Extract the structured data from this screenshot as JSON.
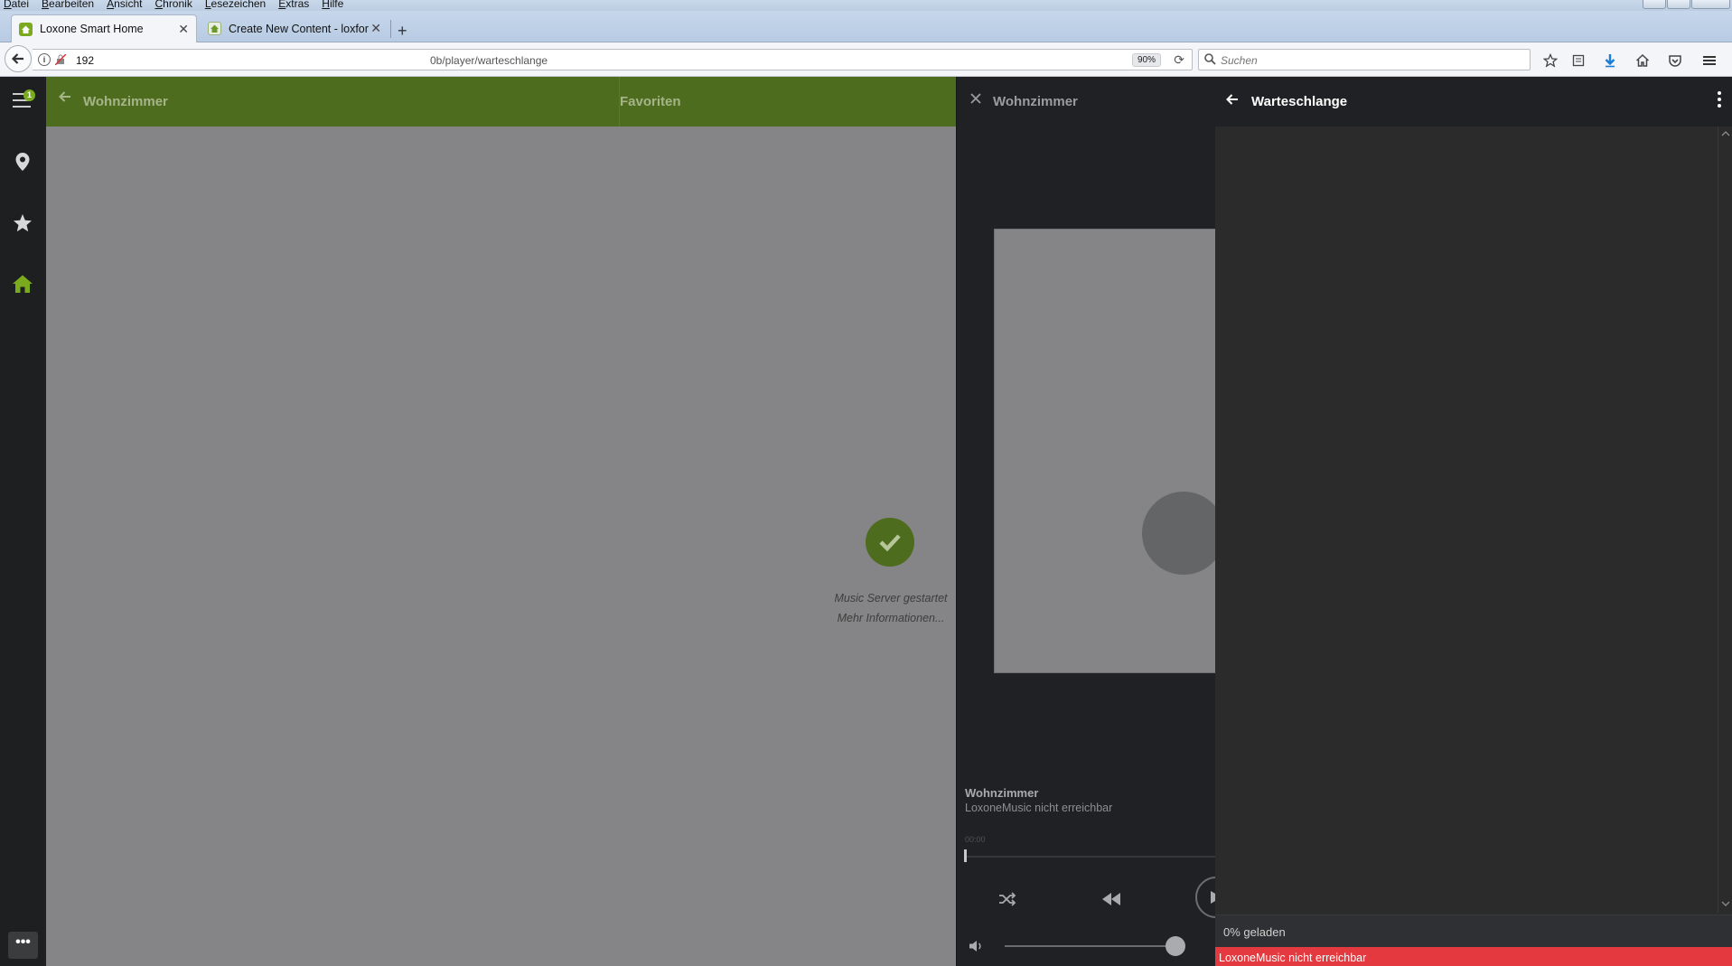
{
  "browser": {
    "menu": [
      "Datei",
      "Bearbeiten",
      "Ansicht",
      "Chronik",
      "Lesezeichen",
      "Extras",
      "Hilfe"
    ],
    "tabs": [
      {
        "label": "Loxone Smart Home",
        "active": true
      },
      {
        "label": "Create New Content - loxforu",
        "active": false
      }
    ],
    "new_tab": "+",
    "url_host": "192",
    "url_path": "0b/player/warteschlange",
    "zoom": "90%",
    "search_placeholder": "Suchen"
  },
  "app": {
    "sidebar": {
      "badge_count": "1",
      "more_label": "•••",
      "accent_color": "#7aab1e"
    },
    "header": {
      "room_title": "Wohnzimmer",
      "favorites_label": "Favoriten"
    },
    "main": {
      "status_line1": "Music Server gestartet",
      "status_line2": "Mehr Informationen..."
    },
    "player": {
      "title": "Wohnzimmer",
      "zone_name": "Wohnzimmer",
      "zone_status": "LoxoneMusic nicht erreichbar",
      "time": "00:00",
      "volume_fraction": 0.9
    },
    "queue": {
      "title": "Warteschlange",
      "loaded_text": "0% geladen",
      "error_text": "LoxoneMusic nicht erreichbar",
      "error_color": "#e3393f"
    }
  }
}
